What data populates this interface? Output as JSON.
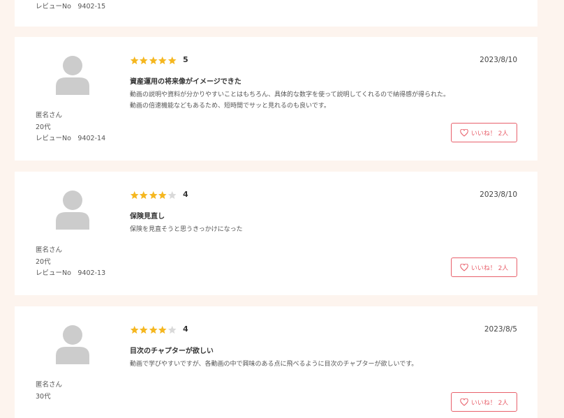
{
  "colors": {
    "star_filled": "#f5b720",
    "star_empty": "#d9d9d9",
    "accent": "#e8606b",
    "background": "#fdf4ee"
  },
  "top_partial": {
    "review_no": "レビューNo　9402-15"
  },
  "reviews": [
    {
      "rating": 5,
      "score_label": "5",
      "date": "2023/8/10",
      "title": "資産運用の将来像がイメージできた",
      "body_lines": [
        "動画の説明や資料が分かりやすいことはもちろん、具体的な数字を使って説明してくれるので納得感が得られた。",
        "動画の倍速機能などもあるため、短時間でサッと見れるのも良いです。"
      ],
      "reviewer": "匿名さん",
      "age": "20代",
      "review_no": "レビューNo　9402-14",
      "like_label": "いいね！ 2人"
    },
    {
      "rating": 4,
      "score_label": "4",
      "date": "2023/8/10",
      "title": "保険見直し",
      "body_lines": [
        "保険を見直そうと思うきっかけになった"
      ],
      "reviewer": "匿名さん",
      "age": "20代",
      "review_no": "レビューNo　9402-13",
      "like_label": "いいね！ 2人"
    },
    {
      "rating": 4,
      "score_label": "4",
      "date": "2023/8/5",
      "title": "目次のチャプターが欲しい",
      "body_lines": [
        "動画で学びやすいですが、各動画の中で興味のある点に飛べるように目次のチャプターが欲しいです。"
      ],
      "reviewer": "匿名さん",
      "age": "30代",
      "review_no": "",
      "like_label": "いいね！ 2人"
    }
  ]
}
